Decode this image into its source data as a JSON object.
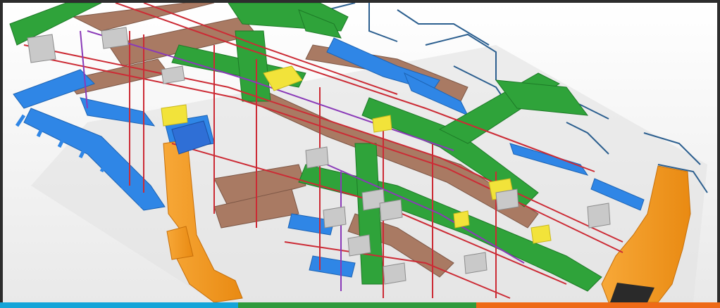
{
  "image": {
    "subject": "isometric-mep-services-model",
    "palette": {
      "background": "#f6f6f6",
      "frame": "#2d2d2d",
      "supply_duct_green": "#2fa33a",
      "chilled_water_blue": "#2f86e6",
      "return_duct_brown": "#a97a63",
      "riser_orange": "#f59a22",
      "pipe_red": "#cc2b35",
      "pipe_purple": "#8a3ab8",
      "drain_dark_blue": "#2c5f8f",
      "equipment_grey": "#c9c9c9",
      "accent_yellow": "#f2e33a"
    }
  },
  "footer_stripes": [
    {
      "color": "#14a4d8",
      "fraction": 0.333
    },
    {
      "color": "#2f9a3c",
      "fraction": 0.333
    },
    {
      "color": "#ee6a17",
      "fraction": 0.334
    }
  ]
}
